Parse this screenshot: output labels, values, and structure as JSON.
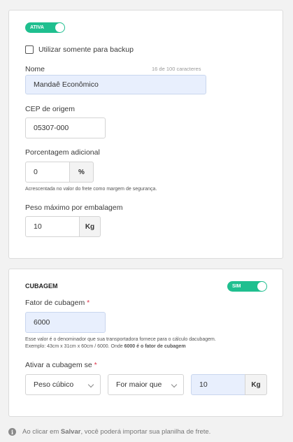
{
  "card1": {
    "status_toggle": {
      "label": "ATIVA",
      "on": true,
      "color": "#1fbf8f"
    },
    "backup_checkbox": {
      "label": "Utilizar somente para backup",
      "checked": false
    },
    "name": {
      "label": "Nome",
      "counter": "16 de 100 caracteres",
      "value": "Mandaê Econômico"
    },
    "cep": {
      "label": "CEP de origem",
      "value": "05307-000"
    },
    "percent": {
      "label": "Porcentagem adicional",
      "value": "0",
      "unit": "%",
      "hint": "Acrescentada no valor do frete como margem de segurança."
    },
    "max_weight": {
      "label": "Peso máximo por embalagem",
      "value": "10",
      "unit": "Kg"
    }
  },
  "card2": {
    "title": "CUBAGEM",
    "toggle": {
      "label": "SIM",
      "on": true
    },
    "factor": {
      "label": "Fator de cubagem",
      "required": "*",
      "value": "6000"
    },
    "hint_line1": "Esse valor é o denominador que sua transportadora fornece para o cálculo dacubagem.",
    "hint_line2_prefix": "Exemplo: 43cm x 31cm x 60cm / 6000. Onde ",
    "hint_line2_bold": "6000 é o fator de cubagem",
    "activate": {
      "label": "Ativar a cubagem se",
      "required": "*"
    },
    "condition_select": "Peso cúbico",
    "operator_select": "For maior que",
    "threshold": {
      "value": "10",
      "unit": "Kg"
    }
  },
  "footer": {
    "text_prefix": "Ao clicar em ",
    "text_bold": "Salvar",
    "text_suffix": ", você poderá importar sua planilha de frete.",
    "icon": "info-icon"
  }
}
